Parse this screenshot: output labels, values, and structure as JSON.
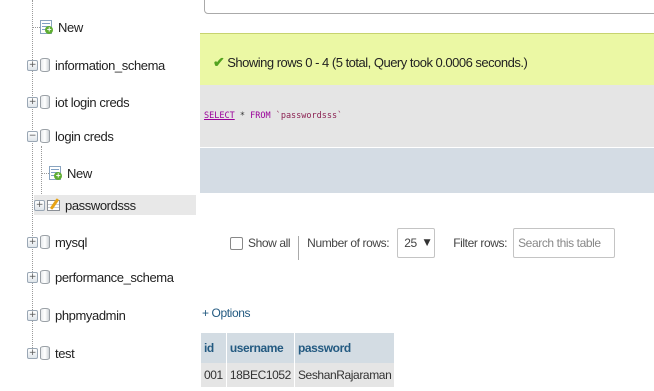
{
  "nav": {
    "nodes": [
      {
        "label": "New"
      },
      {
        "label": "information_schema"
      },
      {
        "label": "iot login creds"
      },
      {
        "label": "login creds"
      },
      {
        "label": "New"
      },
      {
        "label": "passwordsss"
      },
      {
        "label": "mysql"
      },
      {
        "label": "performance_schema"
      },
      {
        "label": "phpmyadmin"
      },
      {
        "label": "test"
      }
    ]
  },
  "result": {
    "message": "Showing rows 0 - 4 (5 total, Query took 0.0006 seconds.)",
    "status_color": "#53a31f"
  },
  "sql": {
    "keyword_select": "SELECT",
    "star": "*",
    "keyword_from": "FROM",
    "table": "`passwordsss`"
  },
  "controls": {
    "show_all_label": "Show all",
    "show_all_checked": false,
    "rows_label": "Number of rows:",
    "rows_value": "25",
    "filter_label": "Filter rows:",
    "search_placeholder": "Search this table"
  },
  "options_link": "+ Options",
  "table": {
    "headers": [
      "id",
      "username",
      "password"
    ],
    "rows": [
      [
        "001",
        "18BEC1052",
        "SeshanRajaraman"
      ]
    ]
  },
  "colors": {
    "result_bar": "#ebf8a4",
    "sql_box": "#e5e5e5",
    "header_bg": "#d3dce3",
    "link": "#235a81"
  }
}
